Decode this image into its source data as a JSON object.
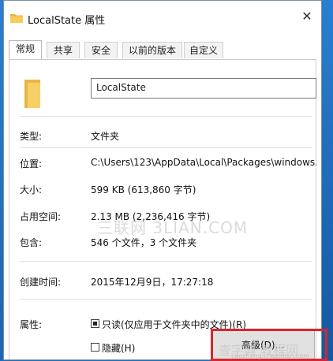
{
  "window": {
    "title": "LocalState 属性",
    "close_glyph": "✕"
  },
  "tabs": [
    {
      "label": "常规",
      "active": true
    },
    {
      "label": "共享",
      "active": false
    },
    {
      "label": "安全",
      "active": false
    },
    {
      "label": "以前的版本",
      "active": false
    },
    {
      "label": "自定义",
      "active": false
    }
  ],
  "general": {
    "folder_name": "LocalState",
    "type_label": "类型:",
    "type_value": "文件夹",
    "location_label": "位置:",
    "location_value": "C:\\Users\\123\\AppData\\Local\\Packages\\windows.i",
    "size_label": "大小:",
    "size_value": "599 KB (613,860 字节)",
    "size_on_disk_label": "占用空间:",
    "size_on_disk_value": "2.13 MB (2,236,416 字节)",
    "contains_label": "包含:",
    "contains_value": "546 个文件，3 个文件夹",
    "created_label": "创建时间:",
    "created_value": "2015年12月9日，17:27:18",
    "attributes_label": "属性:",
    "readonly_label": "只读(仅应用于文件夹中的文件)(R)",
    "readonly_checked": true,
    "hidden_label": "隐藏(H)",
    "hidden_checked": false,
    "advanced_button": "高级(D)..."
  },
  "watermarks": {
    "center": "三联网 3LIAN.COM",
    "corner": "查字典 教程网",
    "corner_small": "jiaocheng.chazidian.com"
  },
  "colors": {
    "desktop": "#1e6fb8",
    "highlight_box": "#d6272c",
    "folder": "#f2c14e"
  }
}
